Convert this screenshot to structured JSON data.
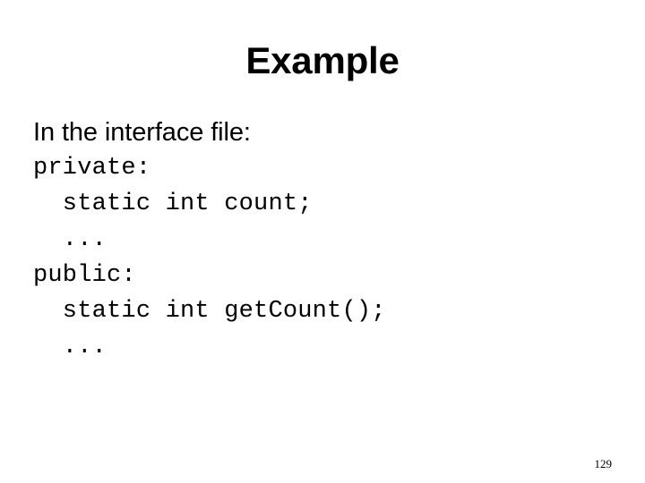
{
  "slide": {
    "title": "Example",
    "page_number": "129",
    "background_color": "#ffffff",
    "text_color": "#000000",
    "body_lines": [
      {
        "kind": "prose",
        "text": "In the interface file:"
      },
      {
        "kind": "code",
        "text": "private:"
      },
      {
        "kind": "code",
        "text": "  static int count;"
      },
      {
        "kind": "code",
        "text": "  ..."
      },
      {
        "kind": "code",
        "text": "public:"
      },
      {
        "kind": "code",
        "text": "  static int getCount();"
      },
      {
        "kind": "code",
        "text": "  ..."
      }
    ]
  }
}
